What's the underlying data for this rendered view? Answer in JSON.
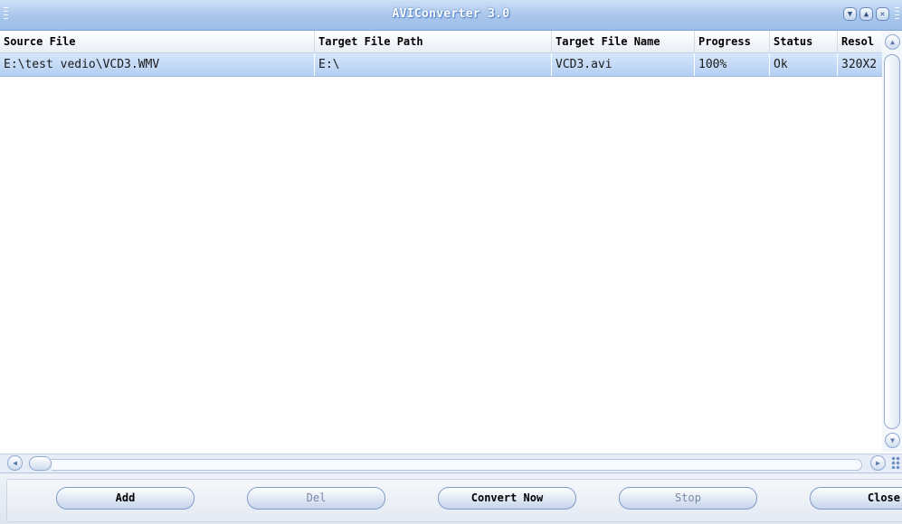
{
  "window": {
    "title": "AVIConverter 3.0",
    "controls": [
      "minimize-icon",
      "maximize-icon",
      "close-icon"
    ]
  },
  "list": {
    "columns": [
      "Source File",
      "Target File Path",
      "Target File Name",
      "Progress",
      "Status",
      "Resol"
    ],
    "rows": [
      [
        "E:\\test vedio\\VCD3.WMV",
        "E:\\",
        "VCD3.avi",
        "100%",
        "Ok",
        "320X2"
      ]
    ]
  },
  "buttons": {
    "add": "Add",
    "del": "Del",
    "convert": "Convert Now",
    "stop": "Stop",
    "close": "Close"
  },
  "colors": {
    "selected_row": "#b4cff2",
    "title_bar": "#a9c6ec"
  }
}
